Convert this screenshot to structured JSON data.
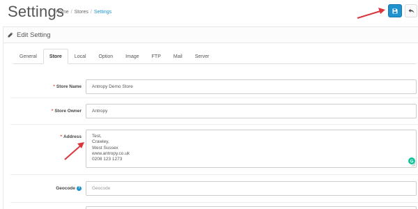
{
  "header": {
    "title": "Settings",
    "breadcrumb": [
      "Home",
      "Stores",
      "Settings"
    ]
  },
  "toolbar": {
    "save_icon": "save-icon",
    "back_icon": "reply-icon"
  },
  "panel": {
    "heading": "Edit Setting",
    "heading_icon": "pencil-icon"
  },
  "tabs": [
    {
      "label": "General",
      "active": false
    },
    {
      "label": "Store",
      "active": true
    },
    {
      "label": "Local",
      "active": false
    },
    {
      "label": "Option",
      "active": false
    },
    {
      "label": "Image",
      "active": false
    },
    {
      "label": "FTP",
      "active": false
    },
    {
      "label": "Mail",
      "active": false
    },
    {
      "label": "Server",
      "active": false
    }
  ],
  "form": {
    "store_name": {
      "label": "Store Name",
      "required": true,
      "value": "Antropy Demo Store"
    },
    "store_owner": {
      "label": "Store Owner",
      "required": true,
      "value": "Antropy"
    },
    "address": {
      "label": "Address",
      "required": true,
      "lines": [
        "Test,",
        "Crawley,",
        "West Sussex",
        "www.antropy.co.uk",
        "0208 123 1273"
      ]
    },
    "geocode": {
      "label": "Geocode",
      "required": false,
      "value": "",
      "placeholder": "Geocode"
    }
  },
  "colors": {
    "primary": "#1e91cf",
    "required": "#e3503e",
    "annotation_arrow": "#d9363e",
    "grammarly": "#15c39a"
  }
}
